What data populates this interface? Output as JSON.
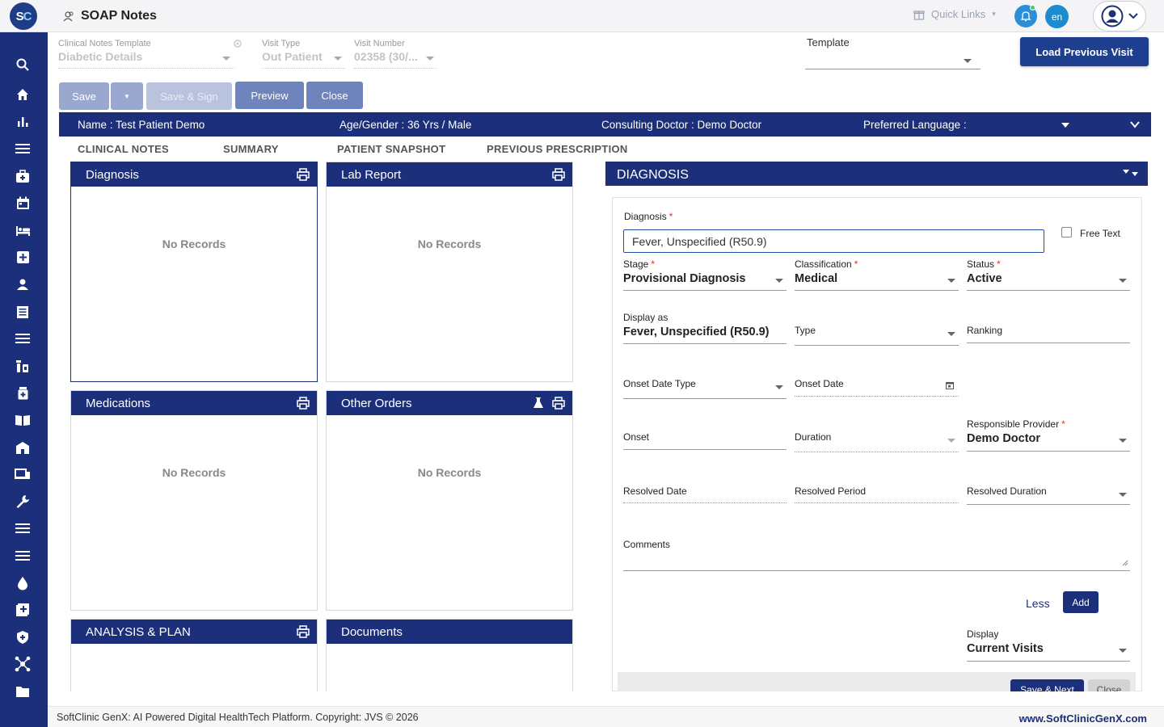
{
  "app": {
    "logo_text_s": "S",
    "logo_text_c": "C",
    "page_title": "SOAP Notes"
  },
  "header": {
    "quick_links": "Quick Links",
    "lang": "en"
  },
  "sidebar": {
    "icons": [
      "search-icon",
      "home-icon",
      "bar-chart-icon",
      "menu-icon",
      "briefcase-medical-icon",
      "calendar-icon",
      "bed-icon",
      "plus-square-icon",
      "user-icon",
      "document-icon",
      "list-icon",
      "medicine-icon",
      "medicine-bottle-icon",
      "book-icon",
      "hospital-icon",
      "devices-icon",
      "wrench-icon",
      "menu-icon-2",
      "menu-icon-3",
      "drop-icon",
      "add-box-icon",
      "shield-icon",
      "network-icon",
      "folder-icon"
    ]
  },
  "form": {
    "template_label": "Clinical Notes Template",
    "template_value": "Diabetic Details",
    "visit_type_label": "Visit Type",
    "visit_type_value": "Out Patient",
    "visit_number_label": "Visit Number",
    "visit_number_value": "02358 (30/...",
    "template2_label": "Template",
    "template2_value": ""
  },
  "buttons": {
    "save": "Save",
    "save_sign": "Save & Sign",
    "preview": "Preview",
    "close": "Close",
    "load_previous": "Load Previous Visit"
  },
  "patient": {
    "name": "Name :  Test Patient Demo",
    "age_gender": "Age/Gender :  36 Yrs / Male",
    "doctor": "Consulting Doctor :  Demo Doctor",
    "language": "Preferred Language :"
  },
  "tabs": [
    "CLINICAL NOTES",
    "SUMMARY",
    "PATIENT SNAPSHOT",
    "PREVIOUS PRESCRIPTION"
  ],
  "panels": {
    "diagnosis": {
      "title": "Diagnosis",
      "empty": "No Records"
    },
    "lab_report": {
      "title": "Lab Report",
      "empty": "No Records"
    },
    "medications": {
      "title": "Medications",
      "empty": "No Records"
    },
    "other_orders": {
      "title": "Other Orders",
      "empty": "No Records"
    },
    "analysis_plan": {
      "title": "ANALYSIS & PLAN"
    },
    "documents": {
      "title": "Documents"
    }
  },
  "diagnosis_form": {
    "heading": "DIAGNOSIS",
    "diagnosis_label": "Diagnosis",
    "diagnosis_value": "Fever, Unspecified (R50.9)",
    "free_text_label": "Free Text",
    "stage_label": "Stage",
    "stage_value": "Provisional Diagnosis",
    "classification_label": "Classification",
    "classification_value": "Medical",
    "status_label": "Status",
    "status_value": "Active",
    "display_as_label": "Display as",
    "display_as_value": "Fever, Unspecified (R50.9)",
    "type_label": "Type",
    "ranking_label": "Ranking",
    "onset_date_type_label": "Onset Date Type",
    "onset_date_label": "Onset Date",
    "onset_label": "Onset",
    "duration_label": "Duration",
    "responsible_provider_label": "Responsible Provider",
    "responsible_provider_value": "Demo Doctor",
    "resolved_date_label": "Resolved Date",
    "resolved_period_label": "Resolved Period",
    "resolved_duration_label": "Resolved Duration",
    "comments_label": "Comments",
    "less_link": "Less",
    "add_button": "Add",
    "display_label": "Display",
    "display_value": "Current Visits",
    "save_next": "Save & Next",
    "close": "Close"
  },
  "footer": {
    "copyright": "SoftClinic GenX: AI Powered Digital HealthTech Platform. Copyright: JVS © 2026",
    "website": "www.SoftClinicGenX.com"
  },
  "colors": {
    "primary": "#1b2f7a",
    "accent": "#2a8fd6",
    "required": "#d9342b"
  }
}
